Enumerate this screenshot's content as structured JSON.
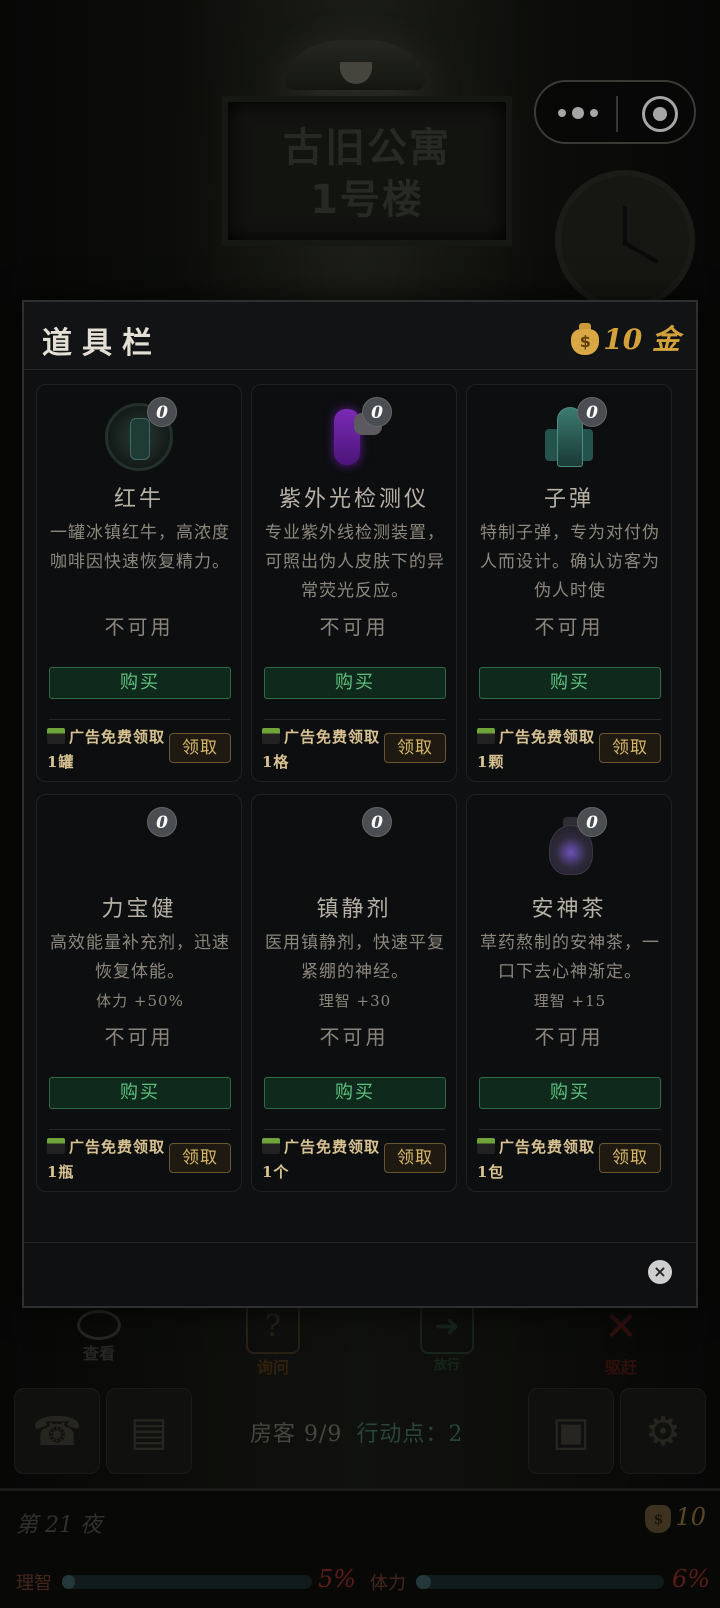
{
  "background": {
    "building_sign": [
      "古旧公寓",
      "1号楼"
    ]
  },
  "modal": {
    "title": "道具栏",
    "gold": "10 金",
    "items": [
      {
        "name": "红牛",
        "count": "0",
        "desc": "一罐冰镇红牛，高浓度咖啡因快速恢复精力。",
        "stat": "",
        "status": "不可用",
        "buy": "购买",
        "ad": "广告免费领取1罐",
        "claim": "领取"
      },
      {
        "name": "紫外光检测仪",
        "count": "0",
        "desc": "专业紫外线检测装置，可照出伪人皮肤下的异常荧光反应。",
        "stat": "",
        "status": "不可用",
        "buy": "购买",
        "ad": "广告免费领取1格",
        "claim": "领取"
      },
      {
        "name": "子弹",
        "count": "0",
        "desc": "特制子弹，专为对付伪人而设计。确认访客为伪人时使",
        "stat": "",
        "status": "不可用",
        "buy": "购买",
        "ad": "广告免费领取1颗",
        "claim": "领取"
      },
      {
        "name": "力宝健",
        "count": "0",
        "desc": "高效能量补充剂，迅速恢复体能。",
        "stat": "体力 +50%",
        "status": "不可用",
        "buy": "购买",
        "ad": "广告免费领取1瓶",
        "claim": "领取"
      },
      {
        "name": "镇静剂",
        "count": "0",
        "desc": "医用镇静剂，快速平复紧绷的神经。",
        "stat": "理智 +30",
        "status": "不可用",
        "buy": "购买",
        "ad": "广告免费领取1个",
        "claim": "领取"
      },
      {
        "name": "安神茶",
        "count": "0",
        "desc": "草药熬制的安神茶，一口下去心神渐定。",
        "stat": "理智 +15",
        "status": "不可用",
        "buy": "购买",
        "ad": "广告免费领取1包",
        "claim": "领取"
      }
    ],
    "close_icon": "×"
  },
  "hud": {
    "actions": [
      "查看",
      "询问",
      "放行",
      "驱赶"
    ],
    "guests": "房客 9/9",
    "action_points": "行动点：2",
    "night": "第 21 夜",
    "gold": "10",
    "sanity_label": "理智",
    "sanity_value": "5%",
    "sanity_level": 0.05,
    "stamina_label": "体力",
    "stamina_value": "6%",
    "stamina_level": 0.06
  },
  "colors": {
    "accent_gold": "#d4a23a",
    "buy_green": "#5ec07e",
    "claim_gold": "#d9b86a"
  }
}
